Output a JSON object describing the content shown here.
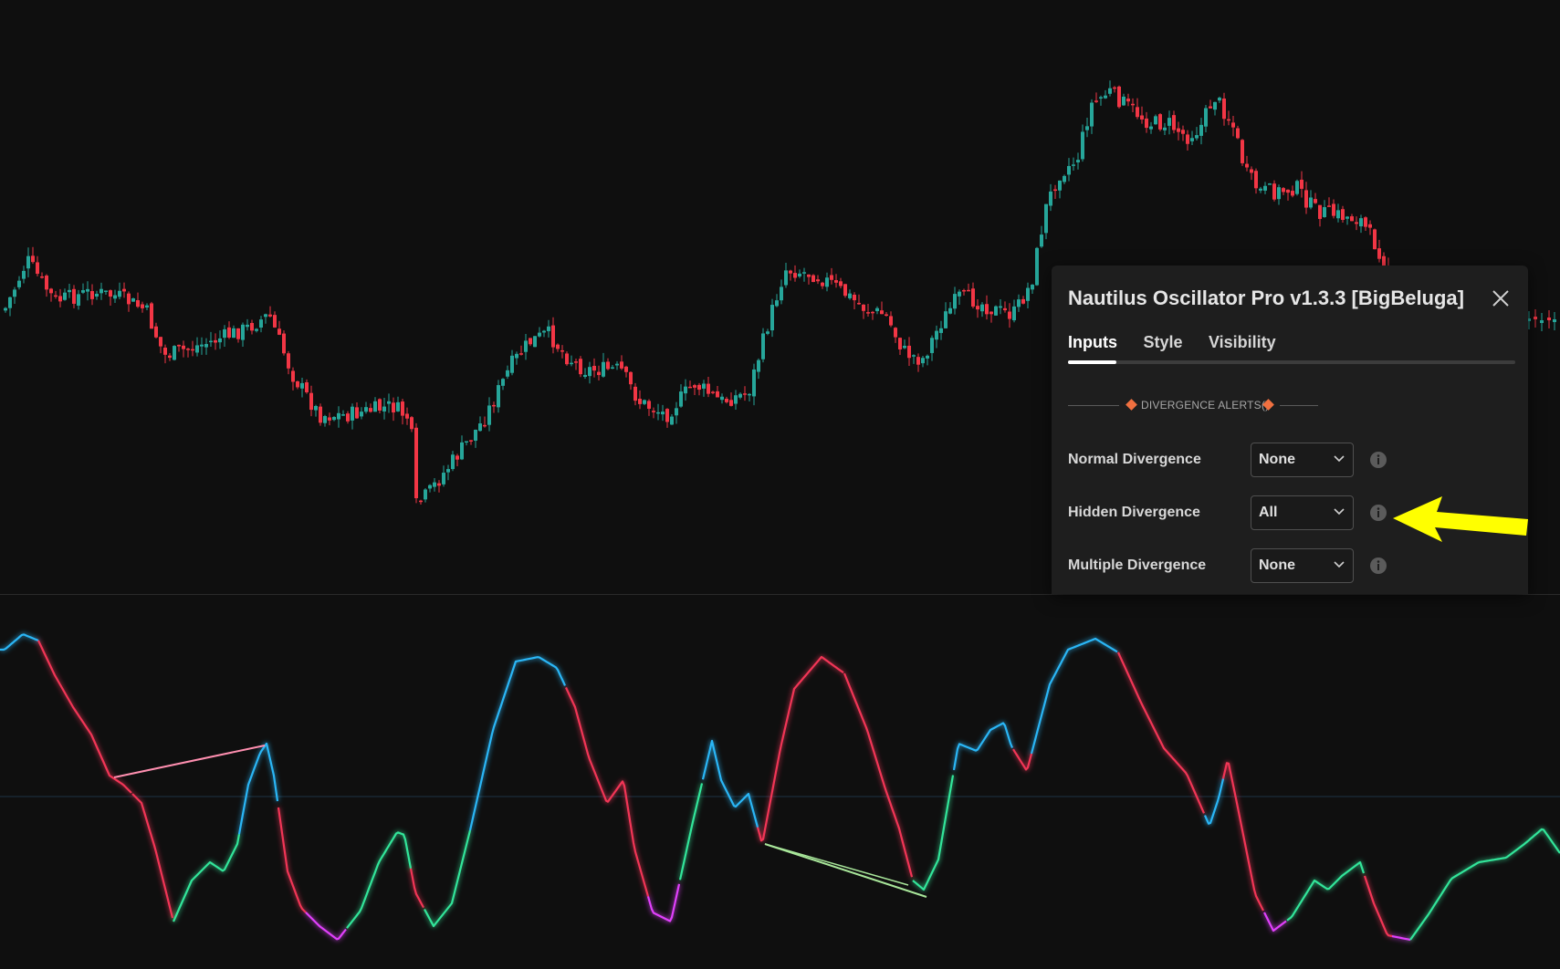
{
  "colors": {
    "background": "#0f0f0f",
    "bull_candle": "#26a69a",
    "bear_candle": "#f23645",
    "osc_blue": "#29b6f6",
    "osc_red": "#f23657",
    "osc_green": "#33e59a",
    "osc_magenta": "#e040fb",
    "div_pink": "#ff8fb0",
    "div_green": "#a8e69a",
    "arrow": "#ffff00",
    "accent_orange": "#f07040"
  },
  "dialog": {
    "title": "Nautilus Oscillator Pro v1.3.3 [BigBeluga]",
    "close_icon": "close-icon",
    "tabs": [
      "Inputs",
      "Style",
      "Visibility"
    ],
    "active_tab": "Inputs",
    "group_title": "DIVERGENCE ALERTS()",
    "settings": [
      {
        "label": "Normal Divergence",
        "value": "None"
      },
      {
        "label": "Hidden Divergence",
        "value": "All"
      },
      {
        "label": "Multiple Divergence",
        "value": "None"
      }
    ]
  },
  "annotation": {
    "icon": "arrow-left-icon",
    "points_to": "Hidden Divergence"
  }
}
